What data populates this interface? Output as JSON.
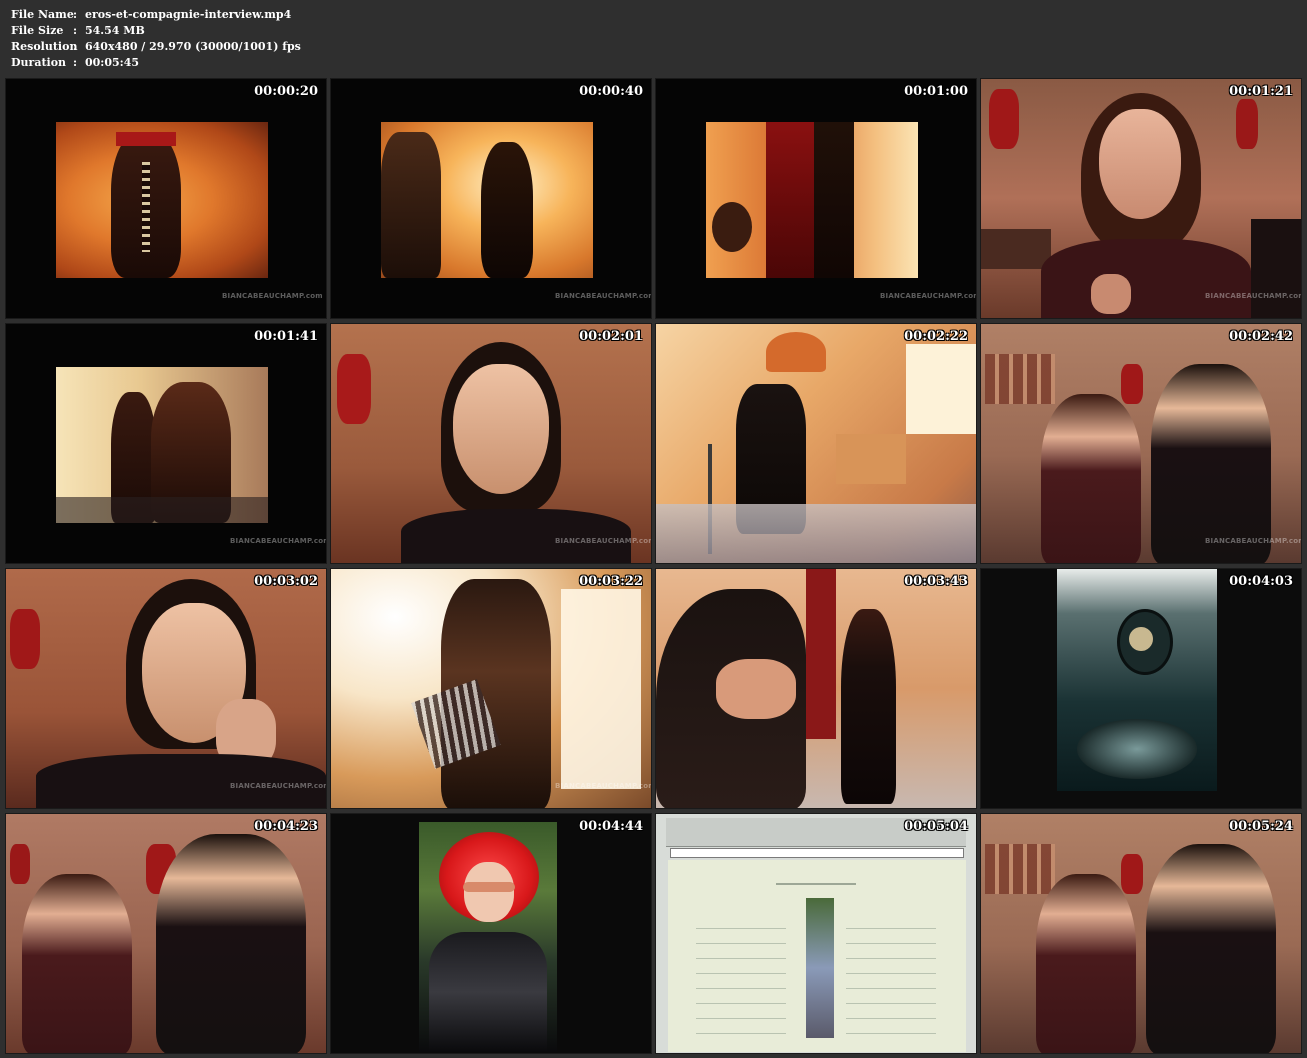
{
  "info": {
    "file_name_label": "File Name",
    "file_name": "eros-et-compagnie-interview.mp4",
    "file_size_label": "File Size",
    "file_size": "54.54 MB",
    "resolution_label": "Resolution",
    "resolution": "640x480 / 29.970 (30000/1001) fps",
    "duration_label": "Duration",
    "duration": "00:05:45",
    "separator": ":"
  },
  "thumbnails": [
    {
      "time": "00:00:20",
      "watermark": "BIANCABEAUCHAMP.com"
    },
    {
      "time": "00:00:40",
      "watermark": "BIANCABEAUCHAMP.com"
    },
    {
      "time": "00:01:00",
      "watermark": "BIANCABEAUCHAMP.com"
    },
    {
      "time": "00:01:21",
      "watermark": "BIANCABEAUCHAMP.com"
    },
    {
      "time": "00:01:41",
      "watermark": "BIANCABEAUCHAMP.com"
    },
    {
      "time": "00:02:01",
      "watermark": "BIANCABEAUCHAMP.com"
    },
    {
      "time": "00:02:22",
      "watermark": ""
    },
    {
      "time": "00:02:42",
      "watermark": "BIANCABEAUCHAMP.com"
    },
    {
      "time": "00:03:02",
      "watermark": "BIANCABEAUCHAMP.com"
    },
    {
      "time": "00:03:22",
      "watermark": "BIANCABEAUCHAMP.com"
    },
    {
      "time": "00:03:43",
      "watermark": ""
    },
    {
      "time": "00:04:03",
      "watermark": ""
    },
    {
      "time": "00:04:23",
      "watermark": ""
    },
    {
      "time": "00:04:44",
      "watermark": ""
    },
    {
      "time": "00:05:04",
      "watermark": ""
    },
    {
      "time": "00:05:24",
      "watermark": ""
    }
  ],
  "colors": {
    "page_background": "#2f2f2f",
    "text": "#ffffff"
  }
}
